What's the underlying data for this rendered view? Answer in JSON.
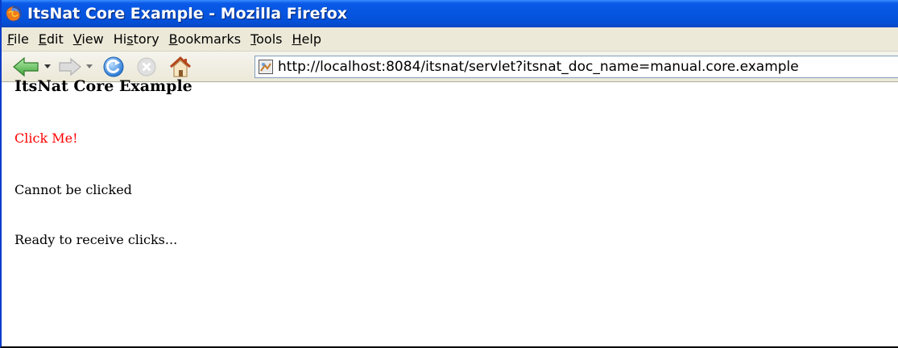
{
  "window": {
    "title": "ItsNat Core Example - Mozilla Firefox"
  },
  "menu": {
    "items": [
      {
        "pre": "",
        "key": "F",
        "post": "ile"
      },
      {
        "pre": "",
        "key": "E",
        "post": "dit"
      },
      {
        "pre": "",
        "key": "V",
        "post": "iew"
      },
      {
        "pre": "Hi",
        "key": "s",
        "post": "tory"
      },
      {
        "pre": "",
        "key": "B",
        "post": "ookmarks"
      },
      {
        "pre": "",
        "key": "T",
        "post": "ools"
      },
      {
        "pre": "",
        "key": "H",
        "post": "elp"
      }
    ]
  },
  "navbar": {
    "url": "http://localhost:8084/itsnat/servlet?itsnat_doc_name=manual.core.example",
    "icons": [
      "back-icon",
      "forward-icon",
      "reload-icon",
      "stop-icon",
      "home-icon",
      "page-icon"
    ]
  },
  "page": {
    "heading": "ItsNat Core Example",
    "click_me": "Click Me!",
    "cannot_click": "Cannot be clicked",
    "status": "Ready to receive clicks..."
  },
  "colors": {
    "titlebar": "#0655e0",
    "chrome": "#ece9d8",
    "link_red": "#ff0000"
  }
}
